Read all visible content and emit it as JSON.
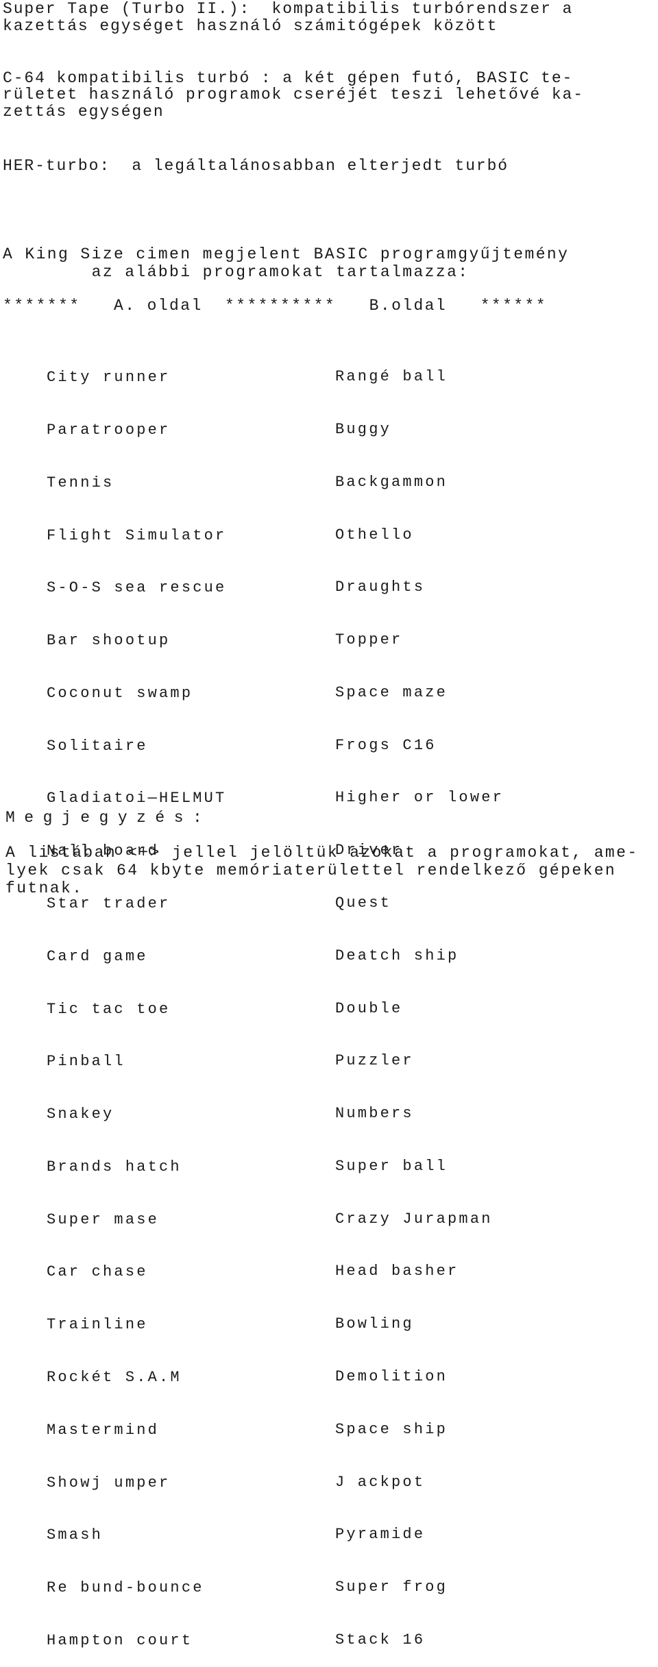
{
  "intro": {
    "super_tape": [
      "Super Tape (Turbo II.):  kompatibilis turbórendszer a",
      "kazettás egységet használó számitógépek között"
    ],
    "c64": [
      "C-64 kompatibilis turbó : a két gépen futó, BASIC te-",
      "rületet használó programok cseréjét teszi lehetővé ka-",
      "zettás egységen"
    ],
    "her_turbo": "HER-turbo:  a legáltalánosabban elterjedt turbó"
  },
  "collection": {
    "heading": [
      "A King Size cimen megjelent BASIC programgyűjtemény",
      "        az alábbi programokat tartalmazza:"
    ],
    "side_header": "*******   A. oldal  **********   B.oldal   ******"
  },
  "side_a": [
    "City runner",
    "Paratrooper",
    "Tennis",
    "Flight Simulator",
    "S-O-S sea rescue",
    "Bar shootup",
    "Coconut swamp",
    "Solitaire",
    "Gladiatoi—HELMUT",
    "Nall board",
    "Star trader",
    "Card game",
    "Tic tac toe",
    "Pinball",
    "Snakey",
    "Brands hatch",
    "Super mase",
    "Car chase",
    "Trainline",
    "Rockét S.A.M",
    "Mastermind",
    "Showj umper",
    "Smash",
    "Re bund-bounce",
    "Hampton court"
  ],
  "side_b": [
    "Rangé ball",
    "Buggy",
    "Backgammon",
    "Othello",
    "Draughts",
    "Topper",
    "Space maze",
    "Frogs C16",
    "Higher or lower",
    "Driver",
    "Quest",
    "Deatch ship",
    "Double",
    "Puzzler",
    "Numbers",
    "Super ball",
    "Crazy Jurapman",
    "Head basher",
    "Bowling",
    "Demolition",
    "Space ship",
    "J ackpot",
    "Pyramide",
    "Super frog",
    "Stack 16"
  ],
  "note": {
    "title": "Megjegyzés:",
    "body": [
      "A listában <+> jellel jelöltük azokat a programokat, ame-",
      "lyek csak 64 kbyte memóriaterülettel rendelkező gépeken",
      "futnak."
    ]
  }
}
